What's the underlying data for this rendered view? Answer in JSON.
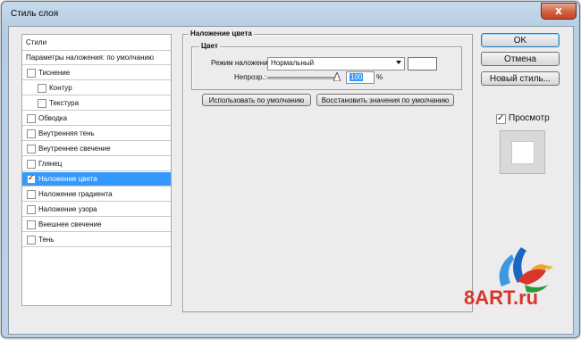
{
  "window": {
    "title": "Стиль слоя",
    "close_label": "x"
  },
  "styles_list": {
    "header": "Стили",
    "items": [
      {
        "label": "Параметры наложения: по умолчанию",
        "has_checkbox": false,
        "checked": false,
        "indent": 0
      },
      {
        "label": "Тиснение",
        "has_checkbox": true,
        "checked": false,
        "indent": 0
      },
      {
        "label": "Контур",
        "has_checkbox": true,
        "checked": false,
        "indent": 1
      },
      {
        "label": "Текстура",
        "has_checkbox": true,
        "checked": false,
        "indent": 1
      },
      {
        "label": "Обводка",
        "has_checkbox": true,
        "checked": false,
        "indent": 0
      },
      {
        "label": "Внутренняя тень",
        "has_checkbox": true,
        "checked": false,
        "indent": 0
      },
      {
        "label": "Внутреннее свечение",
        "has_checkbox": true,
        "checked": false,
        "indent": 0
      },
      {
        "label": "Глянец",
        "has_checkbox": true,
        "checked": false,
        "indent": 0
      },
      {
        "label": "Наложение цвета",
        "has_checkbox": true,
        "checked": true,
        "indent": 0,
        "selected": true
      },
      {
        "label": "Наложение градиента",
        "has_checkbox": true,
        "checked": false,
        "indent": 0
      },
      {
        "label": "Наложение узора",
        "has_checkbox": true,
        "checked": false,
        "indent": 0
      },
      {
        "label": "Внешнее свечение",
        "has_checkbox": true,
        "checked": false,
        "indent": 0
      },
      {
        "label": "Тень",
        "has_checkbox": true,
        "checked": false,
        "indent": 0
      }
    ]
  },
  "panel": {
    "title": "Наложение цвета",
    "group_title": "Цвет",
    "blend_mode_label": "Режим наложения:",
    "blend_mode_value": "Нормальный",
    "overlay_color": "#ffffff",
    "opacity_label": "Непрозр.:",
    "opacity_value": "100",
    "opacity_unit": "%",
    "opacity_fraction": 1.0,
    "btn_use_default": "Использовать по умолчанию",
    "btn_restore_default": "Восстановить значения по умолчанию"
  },
  "actions": {
    "ok": "OK",
    "cancel": "Отмена",
    "new_style": "Новый стиль...",
    "preview_label": "Просмотр",
    "preview_checked": true
  },
  "watermark": {
    "text": "8ART.ru"
  },
  "colors": {
    "selection": "#3399ff",
    "accent_blue": "#1a66c2",
    "watermark_red": "#d8362a"
  }
}
